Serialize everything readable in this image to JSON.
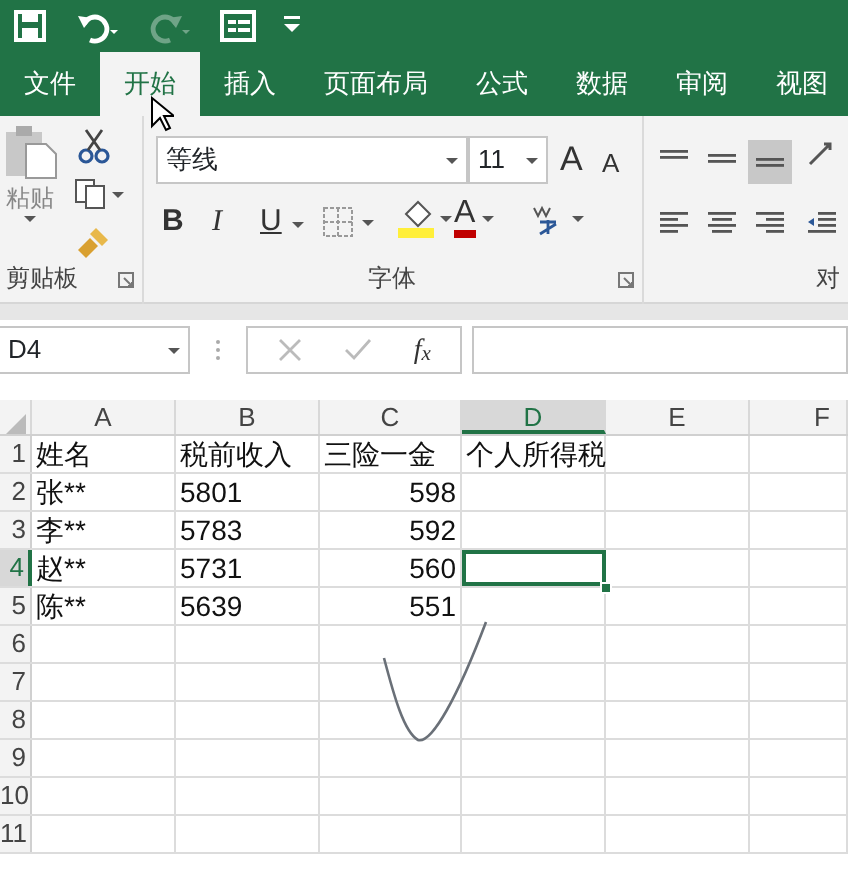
{
  "title_bar": {
    "quick_access": [
      {
        "kind": "save",
        "disabled": false
      },
      {
        "kind": "undo",
        "disabled": false
      },
      {
        "kind": "redo",
        "disabled": true
      },
      {
        "kind": "form",
        "disabled": false
      },
      {
        "kind": "customize",
        "disabled": false
      }
    ]
  },
  "tabs": [
    {
      "label": "文件",
      "selected": false
    },
    {
      "label": "开始",
      "selected": true
    },
    {
      "label": "插入",
      "selected": false
    },
    {
      "label": "页面布局",
      "selected": false
    },
    {
      "label": "公式",
      "selected": false
    },
    {
      "label": "数据",
      "selected": false
    },
    {
      "label": "审阅",
      "selected": false
    },
    {
      "label": "视图",
      "selected": false
    }
  ],
  "ribbon": {
    "clipboard": {
      "paste_label": "粘贴",
      "group_label": "剪贴板"
    },
    "font": {
      "font_name": "等线",
      "font_size": "11",
      "grow": "A",
      "shrink": "A",
      "bold": "B",
      "italic": "I",
      "underline": "U",
      "font_color": "A",
      "group_label": "字体"
    },
    "alignment": {
      "group_label": "对"
    }
  },
  "formula_bar": {
    "name_box": "D4",
    "fx": "f$_{x}$"
  },
  "sheet": {
    "columns": [
      {
        "label": "A",
        "selected": false
      },
      {
        "label": "B",
        "selected": false
      },
      {
        "label": "C",
        "selected": false
      },
      {
        "label": "D",
        "selected": true
      },
      {
        "label": "E",
        "selected": false
      },
      {
        "label": "F",
        "selected": false
      }
    ],
    "rows": [
      {
        "number": "1",
        "selected": false,
        "cells": [
          {
            "text": "姓名",
            "kind": "text",
            "selected": false
          },
          {
            "text": "税前收入",
            "kind": "text",
            "selected": false
          },
          {
            "text": "三险一金",
            "kind": "text",
            "selected": false
          },
          {
            "text": "个人所得税",
            "kind": "text",
            "selected": false
          }
        ]
      },
      {
        "number": "2",
        "selected": false,
        "cells": [
          {
            "text": "张**",
            "kind": "text",
            "selected": false
          },
          {
            "text": "5801",
            "kind": "text",
            "selected": false
          },
          {
            "text": "598",
            "kind": "number",
            "selected": false
          }
        ]
      },
      {
        "number": "3",
        "selected": false,
        "cells": [
          {
            "text": "李**",
            "kind": "text",
            "selected": false
          },
          {
            "text": "5783",
            "kind": "text",
            "selected": false
          },
          {
            "text": "592",
            "kind": "number",
            "selected": false
          }
        ]
      },
      {
        "number": "4",
        "selected": true,
        "cells": [
          {
            "text": "赵**",
            "kind": "text",
            "selected": false
          },
          {
            "text": "5731",
            "kind": "text",
            "selected": false
          },
          {
            "text": "560",
            "kind": "number",
            "selected": false
          },
          {
            "kind": "text",
            "selected": true
          }
        ]
      },
      {
        "number": "5",
        "selected": false,
        "cells": [
          {
            "text": "陈**",
            "kind": "text",
            "selected": false
          },
          {
            "text": "5639",
            "kind": "text",
            "selected": false
          },
          {
            "text": "551",
            "kind": "number",
            "selected": false
          }
        ]
      },
      {
        "number": "6",
        "selected": false
      },
      {
        "number": "7",
        "selected": false
      },
      {
        "number": "8",
        "selected": false
      },
      {
        "number": "9",
        "selected": false
      },
      {
        "number": "10",
        "selected": false
      },
      {
        "number": "11",
        "selected": false
      }
    ]
  }
}
